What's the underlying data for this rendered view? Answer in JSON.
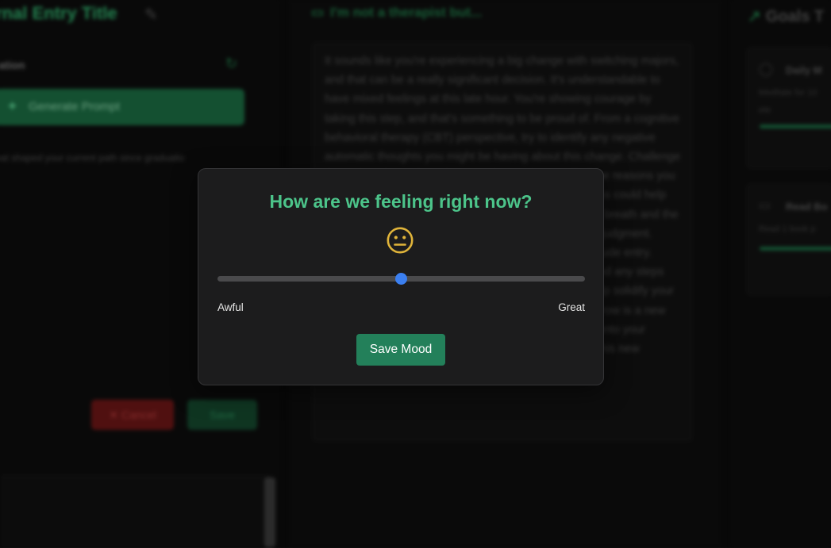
{
  "background": {
    "journal_title": "rnal Entry Title",
    "section_label": "ation",
    "generate_label": "Generate Prompt",
    "hint_text": "hat shaped your current path since graduatio",
    "cancel_label": "✕ Cancel",
    "save_label": "Save",
    "chat_header": "I'm not a therapist but...",
    "message": "It sounds like you're experiencing a big change with switching majors, and that can be a really significant decision. It's understandable to have mixed feelings at this late hour. You're showing courage by taking this step, and that's something to be proud of. From a cognitive behavioral therapy (CBT) perspective, try to identify any negative automatic thoughts you might be having about this change. Challenge those thoughts with evidence and remind yourself of the reasons you chose this new path. Additionally, practicing mindfulness could help you feel more grounded; take a moment to notice your breath and the present moment, acknowledging your feelings without judgment. Consider setting a small goal for tomorrow, like a gratitude entry. Reflect on what excites you about this new direction and any steps you've taken. This positive reinforcement can really help solidify your decision. Be kind to yourself and get some rest. Tomorrow is a new day where you'll see it from a fresh perspective. Hold onto your positive intention and the excitement that comes with this new beginning. You've got this!",
    "goals_header": "Goals T",
    "goals": [
      {
        "title": "Daily M",
        "desc": "Meditate for 10",
        "desc2": "ete"
      },
      {
        "title": "Read Bo",
        "desc": "Read 1 book p"
      }
    ]
  },
  "modal": {
    "title": "How are we feeling right now?",
    "mood_emoji": "neutral-face",
    "mood_value": 0.5,
    "slider_low_label": "Awful",
    "slider_high_label": "Great",
    "save_button": "Save Mood",
    "colors": {
      "title": "#4cc48a",
      "emoji": "#e0b43a",
      "thumb": "#3b7ff0",
      "button": "#23805a"
    }
  }
}
